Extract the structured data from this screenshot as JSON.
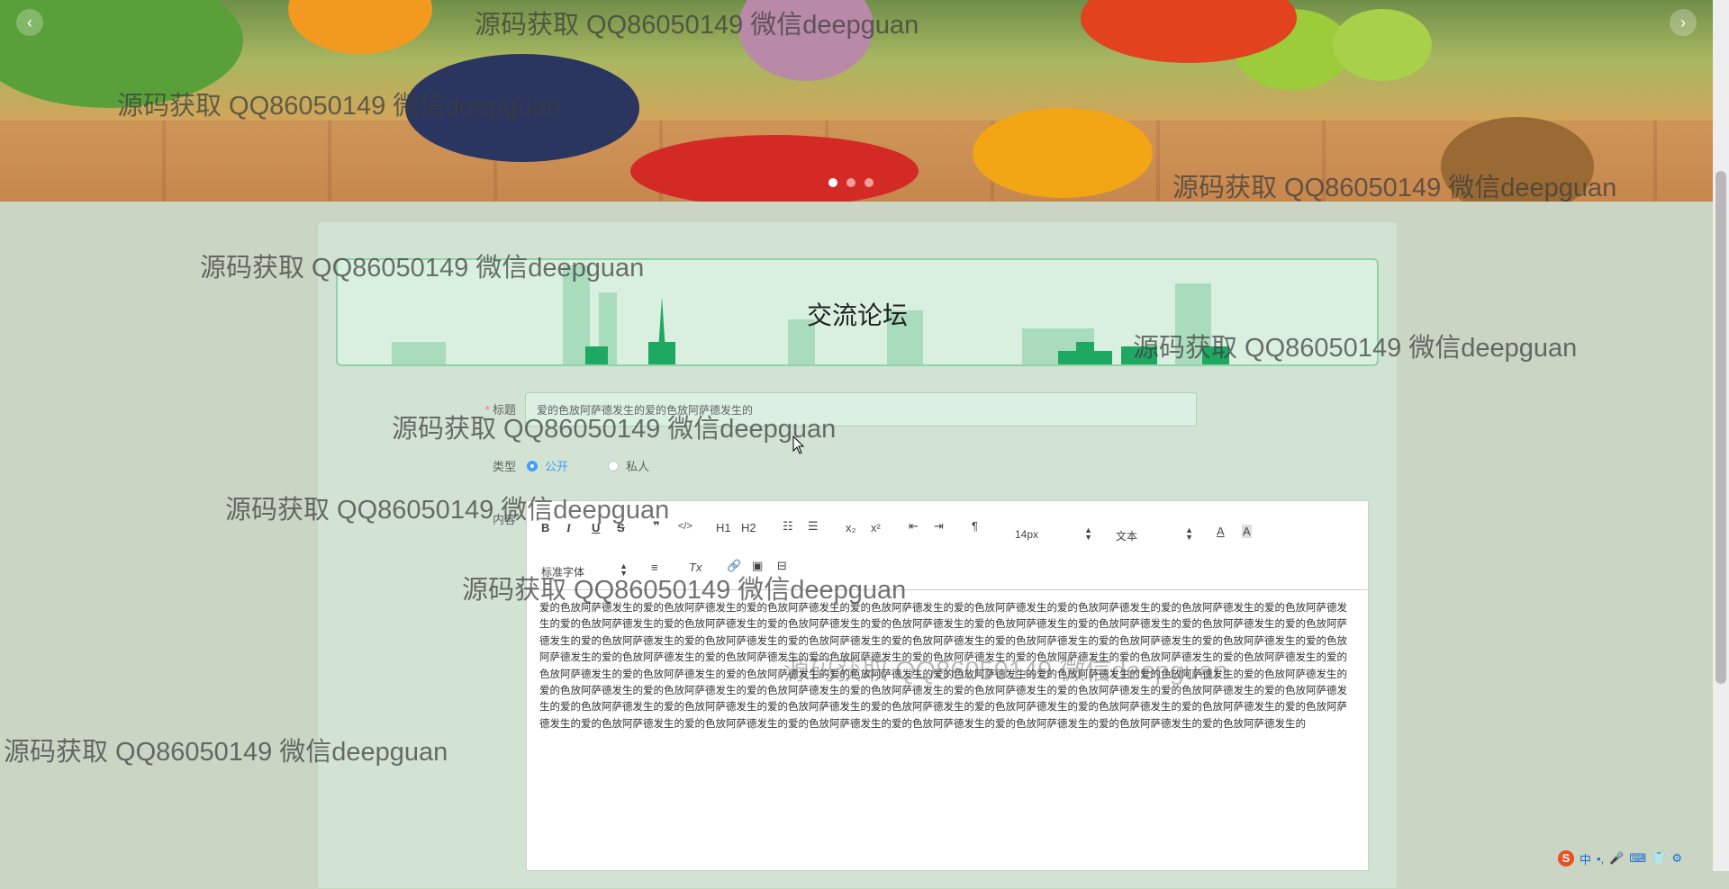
{
  "banner": {
    "prev_icon": "chevron-left-icon",
    "next_icon": "chevron-right-icon",
    "slides_count": 3,
    "active_slide": 1
  },
  "page": {
    "title": "交流论坛"
  },
  "form": {
    "title_label": "标题",
    "title_value": "爱的色放阿萨德发生的爱的色放阿萨德发生的",
    "type_label": "类型",
    "type_options": [
      "公开",
      "私人"
    ],
    "type_selected": "公开",
    "content_label": "内容"
  },
  "editor": {
    "toolbar_row1": {
      "bold": "B",
      "italic": "I",
      "underline": "U",
      "strike": "S",
      "quote": "❞",
      "code": "</>",
      "h1": "H1",
      "h2": "H2",
      "ordered_list": "☷",
      "bullet_list": "☰",
      "subscript": "x₂",
      "superscript": "x²",
      "outdent": "⇤",
      "indent": "⇥",
      "direction": "¶",
      "size_value": "14px",
      "format_value": "文本",
      "color": "A",
      "background": "A"
    },
    "toolbar_row2": {
      "font_value": "标准字体",
      "align": "≡",
      "clean": "Tx"
    },
    "content": "爱的色放阿萨德发生的爱的色放阿萨德发生的爱的色放阿萨德发生的爱的色放阿萨德发生的爱的色放阿萨德发生的爱的色放阿萨德发生的爱的色放阿萨德发生的爱的色放阿萨德发生的爱的色放阿萨德发生的爱的色放阿萨德发生的爱的色放阿萨德发生的爱的色放阿萨德发生的爱的色放阿萨德发生的爱的色放阿萨德发生的爱的色放阿萨德发生的爱的色放阿萨德发生的爱的色放阿萨德发生的爱的色放阿萨德发生的爱的色放阿萨德发生的爱的色放阿萨德发生的爱的色放阿萨德发生的爱的色放阿萨德发生的爱的色放阿萨德发生的爱的色放阿萨德发生的爱的色放阿萨德发生的爱的色放阿萨德发生的爱的色放阿萨德发生的爱的色放阿萨德发生的爱的色放阿萨德发生的爱的色放阿萨德发生的爱的色放阿萨德发生的爱的色放阿萨德发生的爱的色放阿萨德发生的爱的色放阿萨德发生的爱的色放阿萨德发生的爱的色放阿萨德发生的爱的色放阿萨德发生的爱的色放阿萨德发生的爱的色放阿萨德发生的爱的色放阿萨德发生的爱的色放阿萨德发生的爱的色放阿萨德发生的爱的色放阿萨德发生的爱的色放阿萨德发生的爱的色放阿萨德发生的爱的色放阿萨德发生的爱的色放阿萨德发生的爱的色放阿萨德发生的爱的色放阿萨德发生的爱的色放阿萨德发生的爱的色放阿萨德发生的爱的色放阿萨德发生的爱的色放阿萨德发生的爱的色放阿萨德发生的爱的色放阿萨德发生的爱的色放阿萨德发生的爱的色放阿萨德发生的爱的色放阿萨德发生的爱的色放阿萨德发生的爱的色放阿萨德发生的爱的色放阿萨德发生的爱的色放阿萨德发生的"
  },
  "watermark": "源码获取 QQ86050149 微信deepguan",
  "tray": {
    "ime_logo": "S",
    "ime_mode": "中",
    "items": [
      "•,",
      "🎤",
      "⌨",
      "👕",
      "⚙"
    ]
  },
  "colors": {
    "accent": "#409eff",
    "page_bg": "#cad5c4",
    "card_bg": "#d2e3d3",
    "title_border": "#8fd3a6"
  }
}
